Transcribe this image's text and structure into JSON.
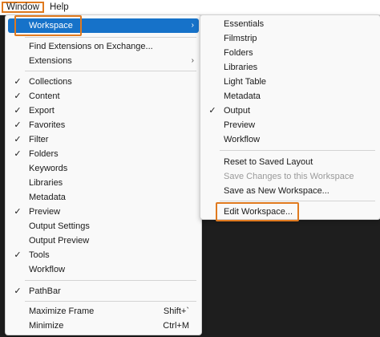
{
  "menubar": {
    "window": "Window",
    "help": "Help"
  },
  "main_menu": {
    "workspace": "Workspace",
    "find_extensions": "Find Extensions on Exchange...",
    "extensions": "Extensions",
    "panels": [
      "Collections",
      "Content",
      "Export",
      "Favorites",
      "Filter",
      "Folders",
      "Keywords",
      "Libraries",
      "Metadata",
      "Preview",
      "Output Settings",
      "Output Preview",
      "Tools",
      "Workflow"
    ],
    "pathbar": "PathBar",
    "maximize": "Maximize Frame",
    "maximize_shortcut": "Shift+`",
    "minimize": "Minimize",
    "minimize_shortcut": "Ctrl+M",
    "check": "✓",
    "arrow": "›"
  },
  "sub_menu": {
    "workspaces": [
      "Essentials",
      "Filmstrip",
      "Folders",
      "Libraries",
      "Light Table",
      "Metadata",
      "Output",
      "Preview",
      "Workflow"
    ],
    "reset": "Reset to Saved Layout",
    "save_changes": "Save Changes to this Workspace",
    "save_new": "Save as New Workspace...",
    "edit": "Edit Workspace..."
  },
  "colors": {
    "highlight": "#1672c9",
    "callout": "#e07a1f"
  }
}
